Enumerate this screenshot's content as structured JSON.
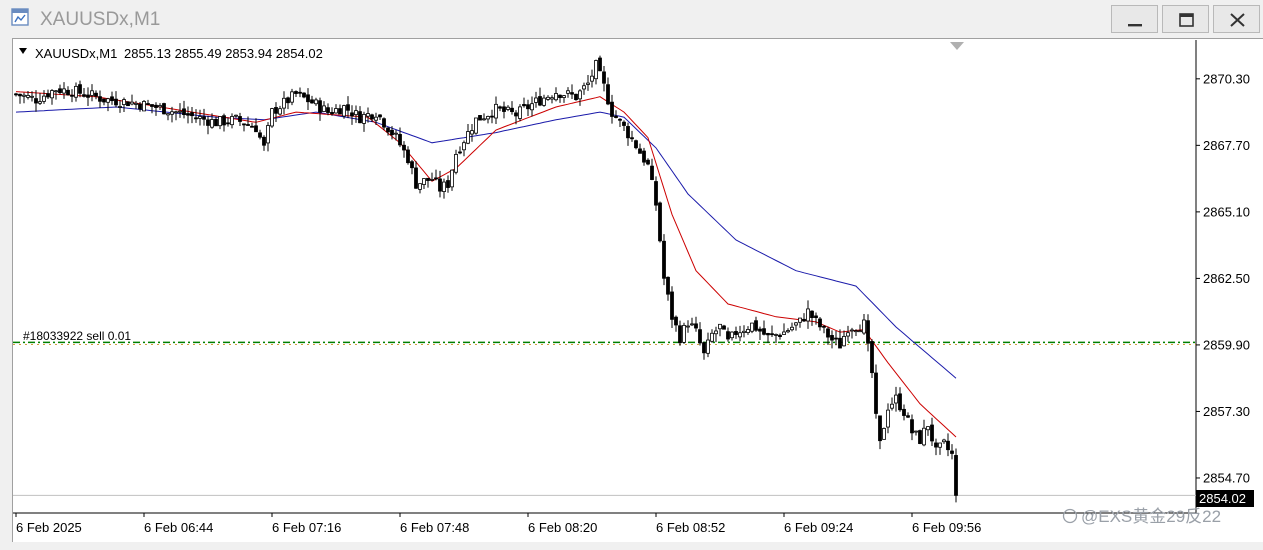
{
  "window": {
    "title": "XAUUSDx,M1",
    "buttons": [
      "minimize",
      "restore",
      "close"
    ]
  },
  "chart_header": {
    "symbol_period": "XAUUSDx,M1",
    "ohlc": "2855.13 2855.49 2853.94 2854.02"
  },
  "order_line": {
    "label": "#18033922 sell 0.01",
    "price": 2860.0,
    "color": "#008000"
  },
  "watermark": "@EXS黄金29反22",
  "colors": {
    "ma_fast": "#cc0000",
    "ma_slow": "#1a1aaa",
    "candle": "#000000",
    "bid_line": "#c0c0c0"
  },
  "chart_data": {
    "type": "candlestick",
    "symbol": "XAUUSDx",
    "timeframe": "M1",
    "y_ticks": [
      "2870.30",
      "2867.70",
      "2865.10",
      "2862.50",
      "2859.90",
      "2857.30",
      "2854.70"
    ],
    "ylim": [
      2853.8,
      2871.7
    ],
    "current_price": "2854.02",
    "x_ticks": [
      "6 Feb 2025",
      "6 Feb 06:44",
      "6 Feb 07:16",
      "6 Feb 07:48",
      "6 Feb 08:20",
      "6 Feb 08:52",
      "6 Feb 09:24",
      "6 Feb 09:56"
    ],
    "close_anchors": [
      [
        0,
        2869.7
      ],
      [
        5,
        2869.5
      ],
      [
        10,
        2869.9
      ],
      [
        15,
        2869.8
      ],
      [
        20,
        2869.6
      ],
      [
        22,
        2869.5
      ],
      [
        28,
        2869.4
      ],
      [
        35,
        2869.2
      ],
      [
        40,
        2869.0
      ],
      [
        45,
        2868.8
      ],
      [
        50,
        2868.6
      ],
      [
        55,
        2868.7
      ],
      [
        60,
        2868.4
      ],
      [
        62,
        2867.6
      ],
      [
        64,
        2869.0
      ],
      [
        70,
        2869.7
      ],
      [
        75,
        2869.3
      ],
      [
        78,
        2869.0
      ],
      [
        82,
        2869.2
      ],
      [
        86,
        2868.8
      ],
      [
        90,
        2869.0
      ],
      [
        92,
        2868.6
      ],
      [
        95,
        2868.0
      ],
      [
        98,
        2867.2
      ],
      [
        100,
        2866.2
      ],
      [
        104,
        2866.4
      ],
      [
        106,
        2866.0
      ],
      [
        108,
        2866.2
      ],
      [
        110,
        2867.4
      ],
      [
        115,
        2868.7
      ],
      [
        120,
        2869.1
      ],
      [
        125,
        2868.9
      ],
      [
        130,
        2869.4
      ],
      [
        135,
        2869.8
      ],
      [
        140,
        2869.6
      ],
      [
        143,
        2870.1
      ],
      [
        145,
        2870.8
      ],
      [
        147,
        2870.0
      ],
      [
        149,
        2869.0
      ],
      [
        152,
        2868.4
      ],
      [
        155,
        2867.7
      ],
      [
        158,
        2866.9
      ],
      [
        160,
        2865.4
      ],
      [
        161,
        2864.0
      ],
      [
        162,
        2862.5
      ],
      [
        164,
        2861.0
      ],
      [
        166,
        2860.2
      ],
      [
        168,
        2860.8
      ],
      [
        170,
        2860.4
      ],
      [
        172,
        2859.5
      ],
      [
        174,
        2860.3
      ],
      [
        176,
        2860.6
      ],
      [
        178,
        2860.0
      ],
      [
        180,
        2860.4
      ],
      [
        184,
        2860.7
      ],
      [
        188,
        2860.2
      ],
      [
        192,
        2860.4
      ],
      [
        196,
        2860.8
      ],
      [
        198,
        2861.2
      ],
      [
        200,
        2860.8
      ],
      [
        204,
        2860.1
      ],
      [
        206,
        2859.9
      ],
      [
        208,
        2860.6
      ],
      [
        212,
        2860.7
      ],
      [
        214,
        2858.8
      ],
      [
        215,
        2857.0
      ],
      [
        216,
        2856.0
      ],
      [
        218,
        2857.5
      ],
      [
        220,
        2857.8
      ],
      [
        222,
        2857.3
      ],
      [
        224,
        2856.5
      ],
      [
        226,
        2856.2
      ],
      [
        228,
        2856.8
      ],
      [
        230,
        2855.7
      ],
      [
        232,
        2856.0
      ],
      [
        234,
        2855.6
      ],
      [
        235,
        2854.02
      ]
    ],
    "ma_fast": [
      [
        0,
        2869.8
      ],
      [
        20,
        2869.6
      ],
      [
        40,
        2869.1
      ],
      [
        60,
        2868.6
      ],
      [
        70,
        2869.0
      ],
      [
        88,
        2868.8
      ],
      [
        96,
        2867.8
      ],
      [
        104,
        2866.3
      ],
      [
        110,
        2866.8
      ],
      [
        120,
        2868.3
      ],
      [
        135,
        2869.2
      ],
      [
        146,
        2869.6
      ],
      [
        152,
        2869.0
      ],
      [
        158,
        2868.0
      ],
      [
        164,
        2865.0
      ],
      [
        170,
        2862.8
      ],
      [
        178,
        2861.5
      ],
      [
        190,
        2861.0
      ],
      [
        200,
        2860.8
      ],
      [
        206,
        2860.4
      ],
      [
        212,
        2860.5
      ],
      [
        218,
        2859.2
      ],
      [
        226,
        2857.6
      ],
      [
        235,
        2856.3
      ]
    ],
    "ma_slow": [
      [
        0,
        2869.0
      ],
      [
        25,
        2869.2
      ],
      [
        50,
        2868.8
      ],
      [
        62,
        2868.7
      ],
      [
        75,
        2869.0
      ],
      [
        90,
        2868.6
      ],
      [
        104,
        2867.8
      ],
      [
        120,
        2868.2
      ],
      [
        135,
        2868.7
      ],
      [
        146,
        2869.0
      ],
      [
        152,
        2868.8
      ],
      [
        160,
        2867.6
      ],
      [
        168,
        2865.8
      ],
      [
        180,
        2864.0
      ],
      [
        195,
        2862.8
      ],
      [
        210,
        2862.2
      ],
      [
        220,
        2860.6
      ],
      [
        235,
        2858.6
      ]
    ]
  }
}
